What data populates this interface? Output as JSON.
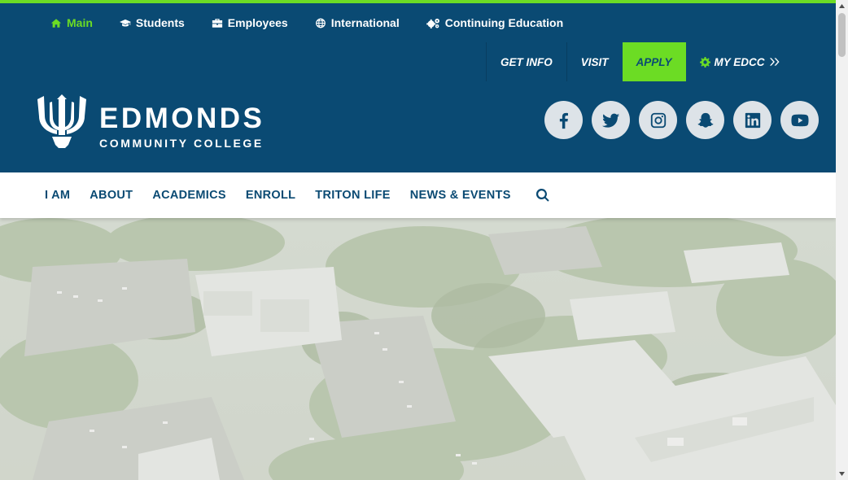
{
  "audience_nav": [
    {
      "label": "Main",
      "icon": "home-icon",
      "active": true
    },
    {
      "label": "Students",
      "icon": "graduation-cap-icon",
      "active": false
    },
    {
      "label": "Employees",
      "icon": "briefcase-icon",
      "active": false
    },
    {
      "label": "International",
      "icon": "globe-icon",
      "active": false
    },
    {
      "label": "Continuing Education",
      "icon": "gears-icon",
      "active": false
    }
  ],
  "cta": {
    "get_info": "GET INFO",
    "visit": "VISIT",
    "apply": "APPLY",
    "my_edcc": "MY EDCC"
  },
  "brand": {
    "name": "EDMONDS",
    "subtitle": "COMMUNITY COLLEGE"
  },
  "social": [
    "facebook-icon",
    "twitter-icon",
    "instagram-icon",
    "snapchat-icon",
    "linkedin-icon",
    "youtube-icon"
  ],
  "main_nav": [
    "I AM",
    "ABOUT",
    "ACADEMICS",
    "ENROLL",
    "TRITON LIFE",
    "NEWS & EVENTS"
  ],
  "colors": {
    "brand_blue": "#0a4a73",
    "accent_green": "#6cdc24",
    "social_bg": "#dde3e8"
  }
}
